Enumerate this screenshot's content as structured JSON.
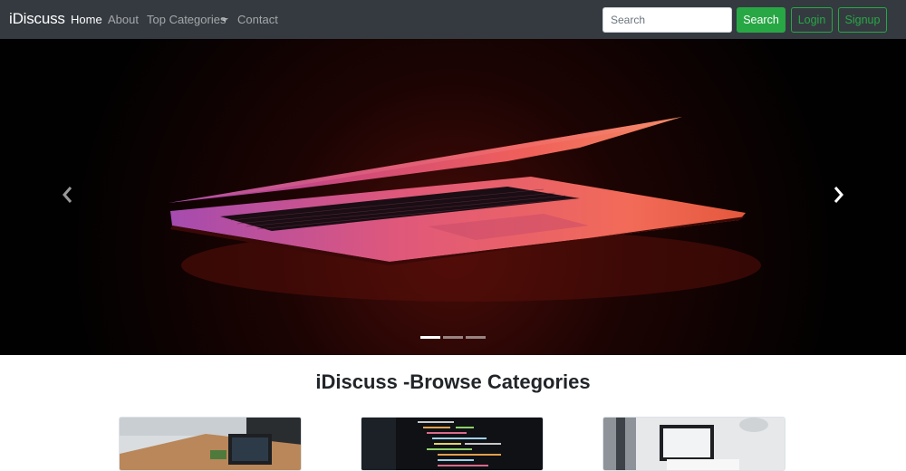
{
  "navbar": {
    "brand": "iDiscuss",
    "links": [
      "Home",
      "About",
      "Top Categories",
      "Contact"
    ],
    "search": {
      "placeholder": "Search",
      "button_label": "Search"
    },
    "login_label": "Login",
    "signup_label": "Signup"
  },
  "carousel": {
    "slide_count": 3,
    "active_slide": 1
  },
  "categories": {
    "title": "iDiscuss -Browse Categories"
  },
  "colors": {
    "navbar_bg": "#343a40",
    "accent_green": "#28a745"
  },
  "icons": [
    "chevron-left-icon",
    "chevron-right-icon"
  ]
}
